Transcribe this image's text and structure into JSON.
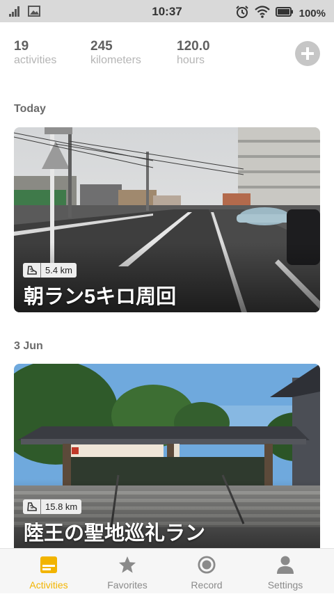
{
  "status_bar": {
    "time": "10:37",
    "battery_percent": "100%",
    "icons": [
      "signal-icon",
      "image-icon",
      "alarm-icon",
      "wifi-icon",
      "battery-icon"
    ]
  },
  "stats": {
    "activities": {
      "value": "19",
      "label": "activities"
    },
    "distance": {
      "value": "245",
      "label": "kilometers"
    },
    "time": {
      "value": "120.0",
      "label": "hours"
    },
    "add_icon": "plus-icon"
  },
  "sections": [
    {
      "heading": "Today",
      "card": {
        "distance": "5.4 km",
        "title": "朝ラン5キロ周回",
        "badge_icon": "shoe-icon"
      }
    },
    {
      "heading": "3 Jun",
      "card": {
        "distance": "15.8 km",
        "title": "陸王の聖地巡礼ラン",
        "badge_icon": "shoe-icon"
      }
    }
  ],
  "tabs": [
    {
      "label": "Activities",
      "icon": "activities-icon",
      "active": true
    },
    {
      "label": "Favorites",
      "icon": "star-icon",
      "active": false
    },
    {
      "label": "Record",
      "icon": "record-icon",
      "active": false
    },
    {
      "label": "Settings",
      "icon": "person-icon",
      "active": false
    }
  ],
  "colors": {
    "accent": "#f2b400",
    "inactive": "#8a8a8a",
    "status_bar": "#d9d9d9"
  }
}
